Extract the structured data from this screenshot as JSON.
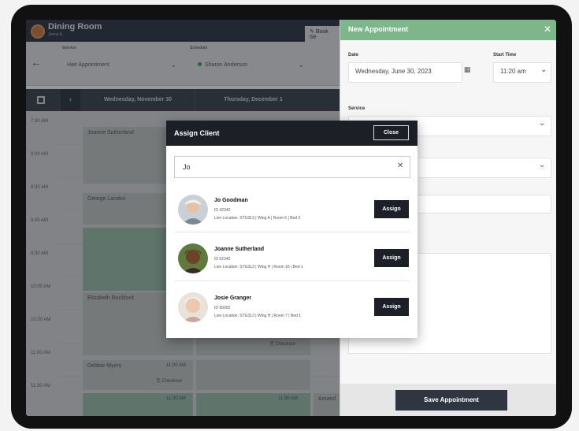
{
  "app": {
    "title": "Dining Room",
    "user": "Jenny A.",
    "book_label": "Book Se"
  },
  "filters": {
    "service_label": "Service",
    "service_value": "Hair Appointment",
    "schedule_label": "Schedule",
    "schedule_value": "Sharon Anderson"
  },
  "calendar": {
    "day1": "Wednesday, November 30",
    "day2": "Thursday, December 1",
    "times": [
      "7:30 AM",
      "8:00 AM",
      "8:30 AM",
      "9:00 AM",
      "9:30 AM",
      "10:00 AM",
      "10:30 AM",
      "11:00 AM",
      "11:30 AM"
    ],
    "appointments": [
      "Joanne Sutherland",
      "George Landon",
      "Elizabeth Rockford",
      "Debbie Myers",
      "Amand"
    ],
    "checkout_label": "Checkout",
    "small_time_1": "11:00 AM",
    "small_time_2": "11:30 AM"
  },
  "panel": {
    "title": "New Appointment",
    "date_label": "Date",
    "date_value": "Wednesday, June 30, 2023",
    "start_label": "Start Time",
    "start_value": "11:20 am",
    "service_label": "Service",
    "save_label": "Save Appointment"
  },
  "modal": {
    "title": "Assign Client",
    "close_label": "Close",
    "search_value": "Jo",
    "assign_label": "Assign",
    "clients": [
      {
        "name": "Jo Goodman",
        "id": "ID 42342",
        "location": "Live Location: STG313 | Wing A | Room 6 | Bed 2"
      },
      {
        "name": "Joanne Sutherland",
        "id": "ID 52342",
        "location": "Live Location: STG313 | Wing H | Room 16 | Bed 1"
      },
      {
        "name": "Josie Granger",
        "id": "ID 90002",
        "location": "Live Location: STG313 | Wing H | Room 7 | Bed 1"
      }
    ]
  }
}
